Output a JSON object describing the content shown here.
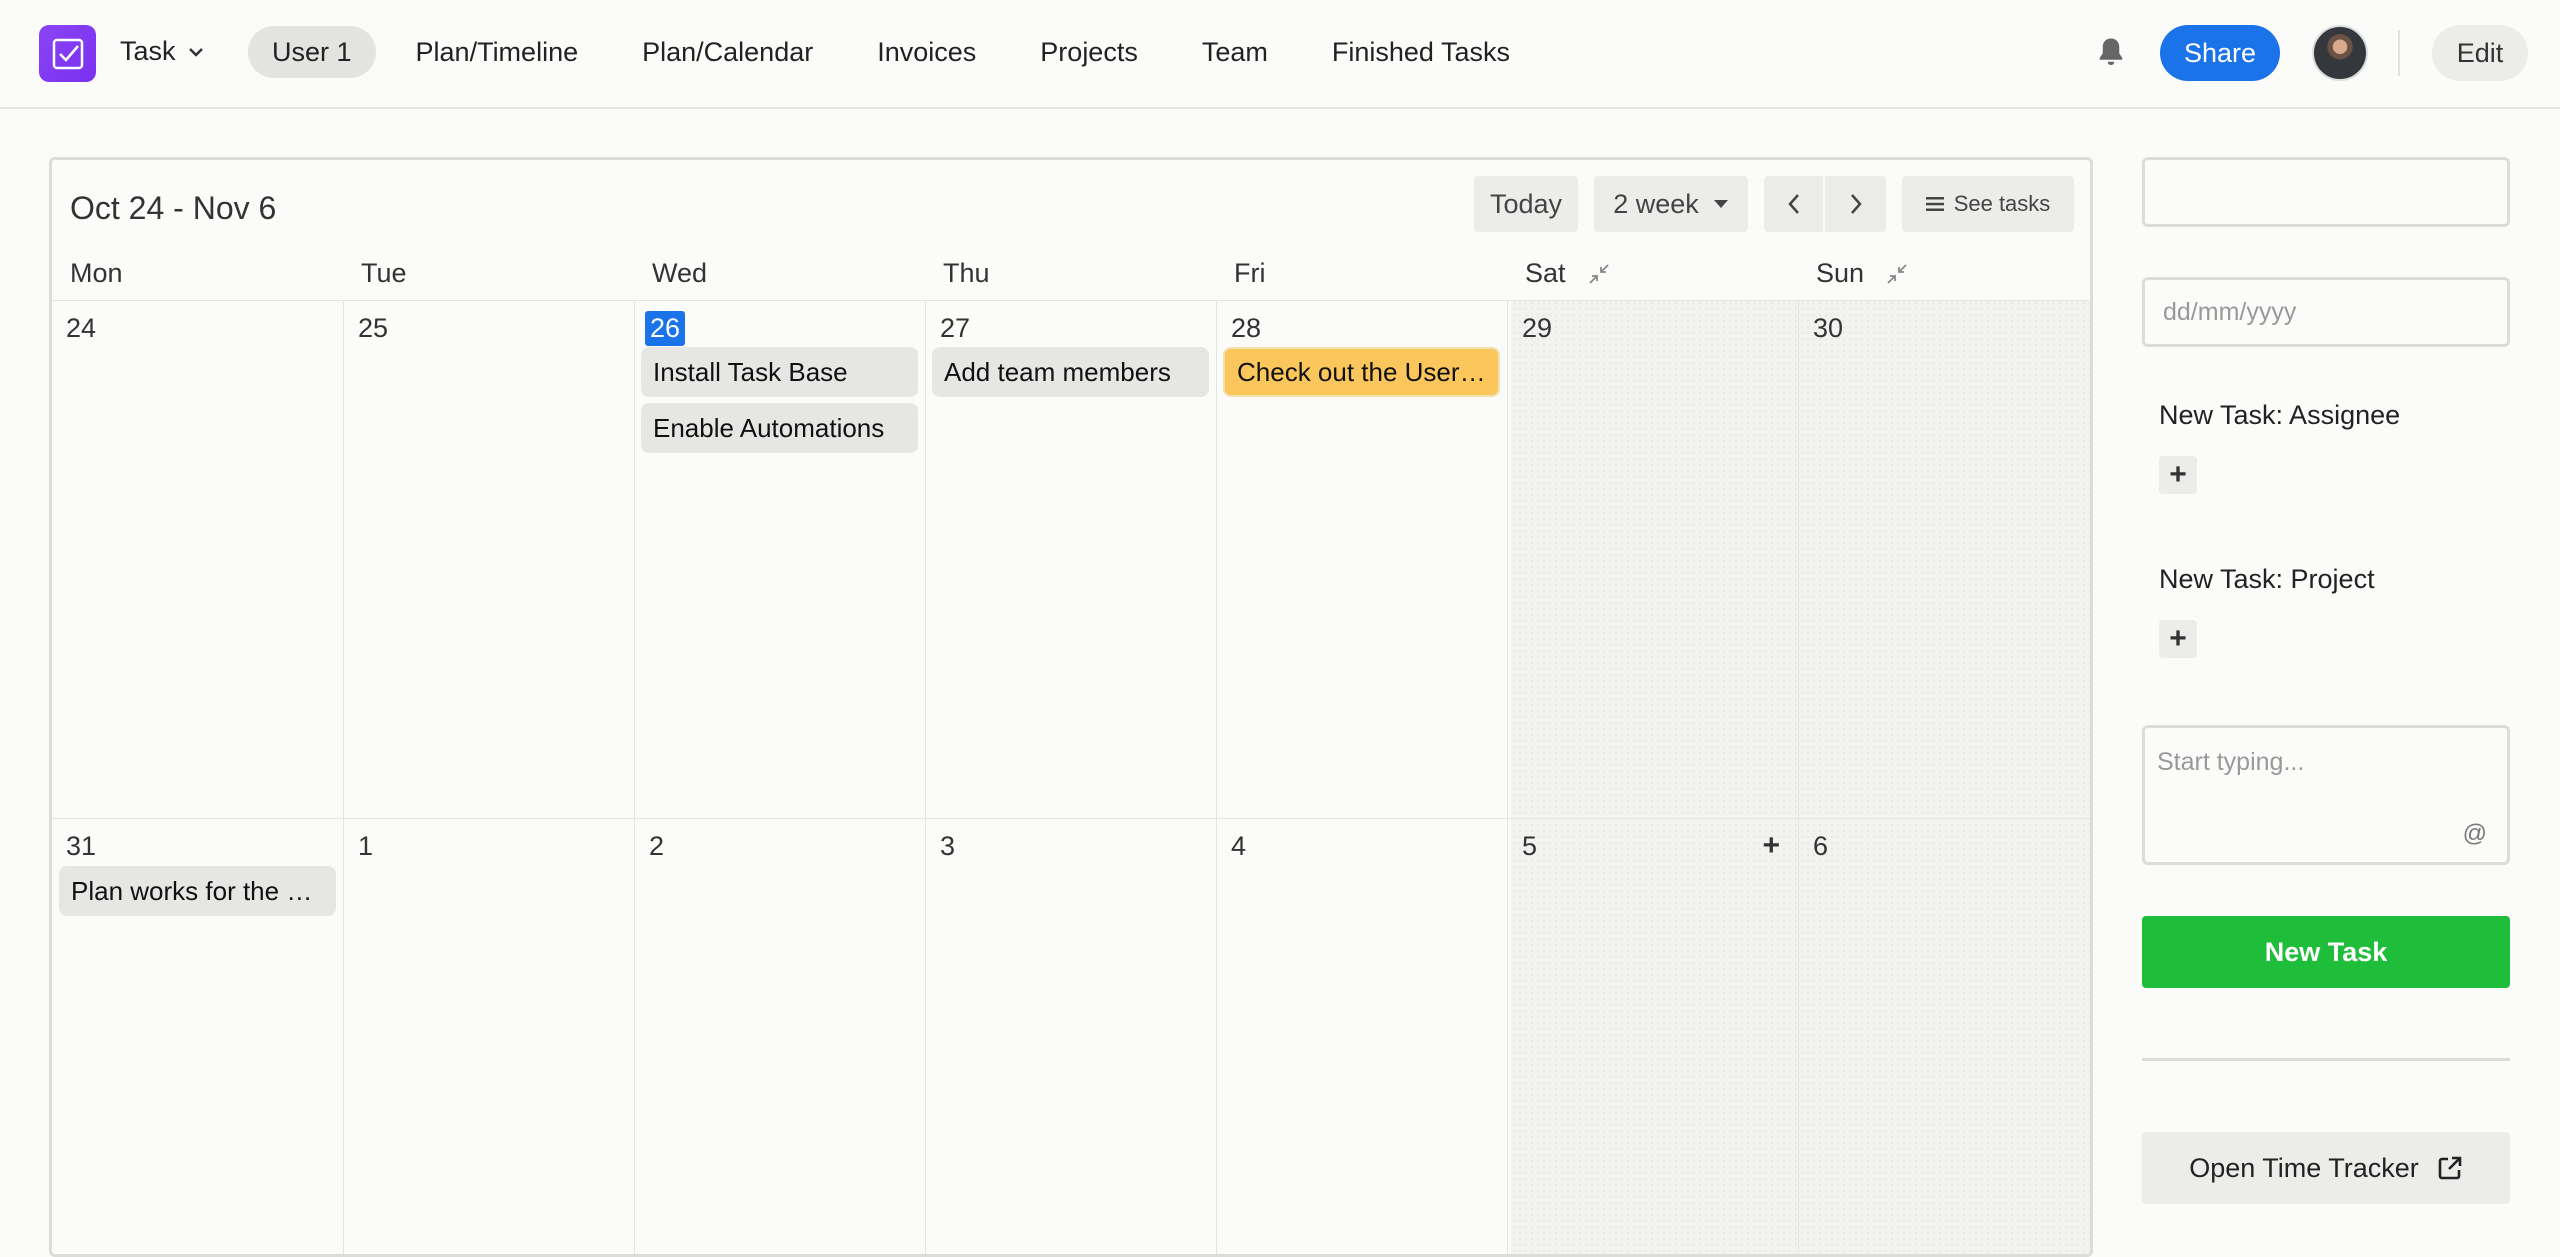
{
  "app": {
    "name": "Task"
  },
  "nav": [
    "User 1",
    "Plan/Timeline",
    "Plan/Calendar",
    "Invoices",
    "Projects",
    "Team",
    "Finished Tasks"
  ],
  "header": {
    "share_label": "Share",
    "edit_label": "Edit"
  },
  "calendar": {
    "title": "Oct 24 - Nov 6",
    "today_label": "Today",
    "range_label": "2 week",
    "see_tasks_label": "See tasks",
    "days": [
      "Mon",
      "Tue",
      "Wed",
      "Thu",
      "Fri",
      "Sat",
      "Sun"
    ],
    "week1": [
      "24",
      "25",
      "26",
      "27",
      "28",
      "29",
      "30"
    ],
    "week2": [
      "31",
      "1",
      "2",
      "3",
      "4",
      "5",
      "6"
    ],
    "today_index": 2,
    "tasks": {
      "install": "Install Task Base",
      "automations": "Enable Automations",
      "team_members": "Add team members",
      "check_out": "Check out the User's Guide",
      "plan_works": "Plan works for the upcoming week"
    }
  },
  "panel": {
    "date_placeholder": "dd/mm/yyyy",
    "assignee_label": "New Task: Assignee",
    "project_label": "New Task: Project",
    "typing_placeholder": "Start typing...",
    "at_symbol": "@",
    "new_task_label": "New Task",
    "time_tracker_label": "Open Time Tracker"
  },
  "colors": {
    "accent": "#1a73e8",
    "logo": "#7a2ff0",
    "new_task": "#1fbe3a",
    "highlight_task": "#fbc65b"
  }
}
